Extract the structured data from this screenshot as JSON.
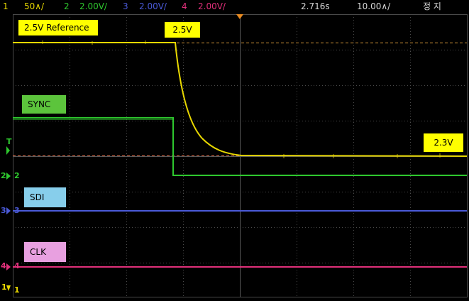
{
  "status_bar": {
    "ch1_num": "1",
    "ch1_scale": "50∧/",
    "ch2_num": "2",
    "ch2_scale": "2.00V/",
    "ch3_num": "3",
    "ch3_scale": "2.00V/",
    "ch4_num": "4",
    "ch4_scale": "2.00V/",
    "time": "2.716s",
    "timebase": "10.00∧/",
    "run_state": "정 지"
  },
  "labels": {
    "reference": "2.5V Reference",
    "v_start": "2.5V",
    "v_end": "2.3V",
    "sync": "SYNC",
    "sdi": "SDI",
    "clk": "CLK"
  },
  "markers": {
    "trigger": "T",
    "ch2_left": "2",
    "ch2_right": "2",
    "ch3_left": "3",
    "ch3_right": "3",
    "ch4_left": "4",
    "ch4_right": "4",
    "ch1_left": "1",
    "ch1_right": "1"
  },
  "colors": {
    "ch1": "#e8d800",
    "ch2": "#2ec82e",
    "ch3": "#4a5ad8",
    "ch4": "#e0307a",
    "grid": "#4a4a4a",
    "label_yellow": "#ffff00",
    "label_green": "#5cc43c",
    "label_blue": "#87ceeb",
    "label_pink": "#e8a0e0"
  }
}
